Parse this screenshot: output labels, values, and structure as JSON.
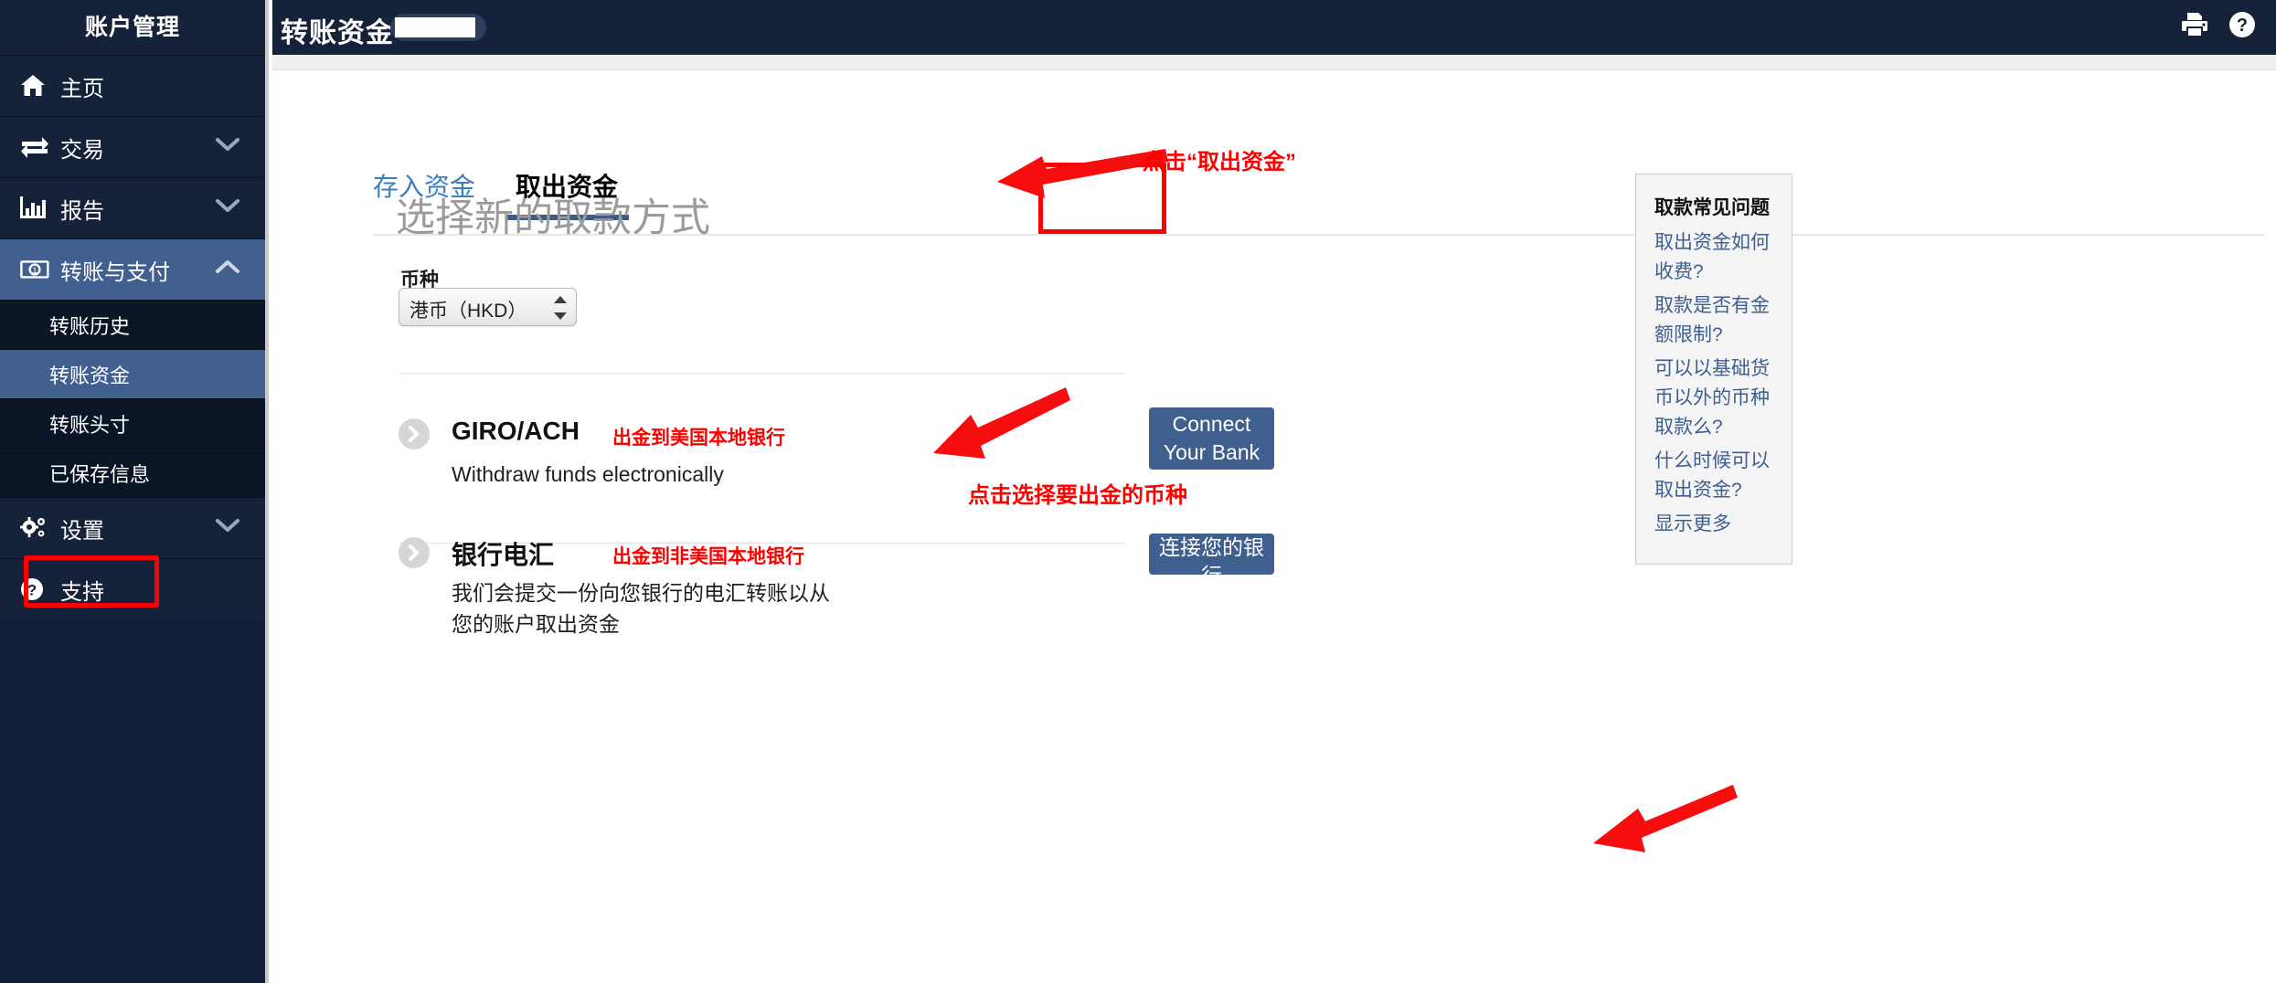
{
  "sidebar": {
    "title": "账户管理",
    "items": [
      {
        "label": "主页",
        "icon": "home-icon",
        "chevron": null,
        "active": false
      },
      {
        "label": "交易",
        "icon": "exchange-icon",
        "chevron": "down",
        "active": false
      },
      {
        "label": "报告",
        "icon": "bar-chart-icon",
        "chevron": "down",
        "active": false
      },
      {
        "label": "转账与支付",
        "icon": "money-bill-icon",
        "chevron": "up",
        "active": true
      },
      {
        "label": "设置",
        "icon": "gears-icon",
        "chevron": "down",
        "active": false
      },
      {
        "label": "支持",
        "icon": "question-circle-icon",
        "chevron": null,
        "active": false
      }
    ],
    "sub_items": [
      {
        "label": "转账历史",
        "active": false
      },
      {
        "label": "转账资金",
        "active": true
      },
      {
        "label": "转账头寸",
        "active": false
      },
      {
        "label": "已保存信息",
        "active": false
      }
    ]
  },
  "header": {
    "title": "转账资金",
    "badge_value": "",
    "print_icon": "printer-icon",
    "help_icon": "help-circle-icon"
  },
  "tabs": [
    {
      "label": "存入资金",
      "active": false
    },
    {
      "label": "取出资金",
      "active": true
    }
  ],
  "main": {
    "heading": "选择新的取款方式",
    "currency": {
      "label": "币种",
      "value": "港币（HKD）"
    },
    "methods": [
      {
        "name": "GIRO/ACH",
        "note": "出金到美国本地银行",
        "description": "Withdraw funds electronically",
        "button": "Connect Your Bank",
        "chevron_icon": "chevron-right-icon"
      },
      {
        "name": "银行电汇",
        "note": "出金到非美国本地银行",
        "description": "我们会提交一份向您银行的电汇转账以从您的账户取出资金",
        "button": "连接您的银行",
        "chevron_icon": "chevron-right-icon"
      }
    ]
  },
  "faq": {
    "title": "取款常见问题",
    "links": [
      "取出资金如何收费?",
      "取款是否有金额限制?",
      "可以以基础货币以外的币种取款么?",
      "什么时候可以取出资金?",
      "显示更多"
    ]
  },
  "annotations": [
    {
      "text": "点击“取出资金”",
      "arrow": "arrow-to-withdraw-tab"
    },
    {
      "text": "点击选择要出金的币种",
      "arrow": "arrow-to-currency-select"
    },
    {
      "text": "",
      "arrow": "arrow-to-connect-bank-button"
    }
  ],
  "colors": {
    "sidebar_bg": "#16223a",
    "sidebar_active": "#41608f",
    "sidebar_sub_bg": "#0a1525",
    "accent_blue": "#3f5f8f",
    "link_blue": "#3a7ec0",
    "annotation_red": "#ff0000"
  }
}
